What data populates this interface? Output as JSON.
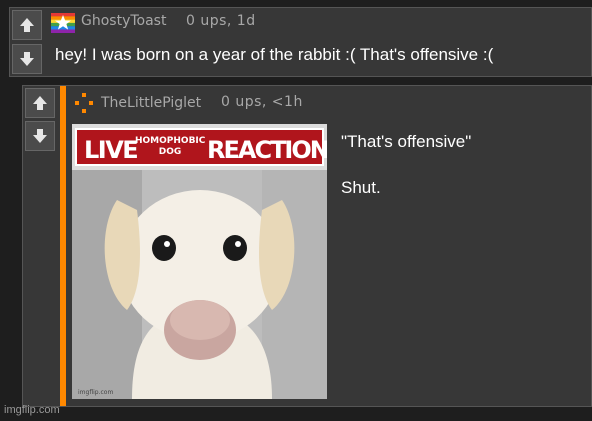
{
  "comment_parent": {
    "username": "GhostyToast",
    "meta": "0 ups, 1d",
    "text": "hey! I was born on a year of the rabbit :( That's offensive :("
  },
  "comment_reply": {
    "username": "TheLittlePiglet",
    "meta": "0 ups, <1h",
    "meme": {
      "banner_left": "LIVE",
      "banner_middle_line1": "HOMOPHOBIC",
      "banner_middle_line2": "DOG",
      "banner_right": "REACTION",
      "watermark": "imgflip.com"
    },
    "text_line1": "\"That's offensive\"",
    "text_line2": "Shut."
  },
  "footer": {
    "watermark": "imgflip.com"
  },
  "colors": {
    "background": "#1e1e1e",
    "comment_bg": "#373737",
    "accent_orange": "#ff8800",
    "banner_red": "#b0151c"
  }
}
